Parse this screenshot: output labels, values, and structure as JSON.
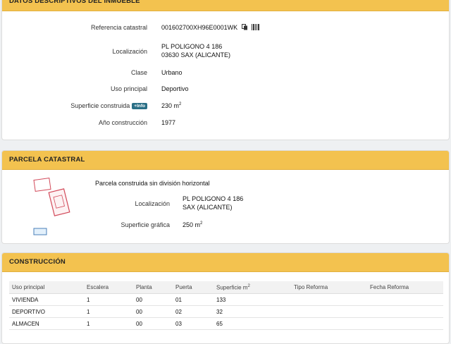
{
  "datos": {
    "header": "DATOS DESCRIPTIVOS DEL INMUEBLE",
    "ref_label": "Referencia catastral",
    "ref_value": "001602700XH96E0001WK",
    "loc_label": "Localización",
    "loc_line1": "PL POLIGONO 4 186",
    "loc_line2": "03630 SAX (ALICANTE)",
    "clase_label": "Clase",
    "clase_value": "Urbano",
    "uso_label": "Uso principal",
    "uso_value": "Deportivo",
    "sup_label": "Superficie construida",
    "info_badge": "+Info",
    "sup_value": "230 m",
    "sup_exp": "2",
    "anio_label": "Año construcción",
    "anio_value": "1977"
  },
  "parcela": {
    "header": "PARCELA CATASTRAL",
    "subtitle": "Parcela construida sin división horizontal",
    "loc_label": "Localización",
    "loc_line1": "PL POLIGONO 4 186",
    "loc_line2": "SAX (ALICANTE)",
    "sup_label": "Superficie gráfica",
    "sup_value": "250 m",
    "sup_exp": "2"
  },
  "construccion": {
    "header": "CONSTRUCCIÓN",
    "columns": [
      "Uso principal",
      "Escalera",
      "Planta",
      "Puerta",
      "Superficie m",
      "Tipo Reforma",
      "Fecha Reforma"
    ],
    "sup_exp": "2",
    "rows": [
      [
        "VIVIENDA",
        "1",
        "00",
        "01",
        "133",
        "",
        ""
      ],
      [
        "DEPORTIVO",
        "1",
        "00",
        "02",
        "32",
        "",
        ""
      ],
      [
        "ALMACEN",
        "1",
        "00",
        "03",
        "65",
        "",
        ""
      ]
    ]
  },
  "colors": {
    "header_bg": "#f3c24f",
    "badge": "#2a6f86",
    "parcel_outline": "#d24a5a"
  },
  "icons": [
    "copy-icon",
    "barcode-icon"
  ]
}
